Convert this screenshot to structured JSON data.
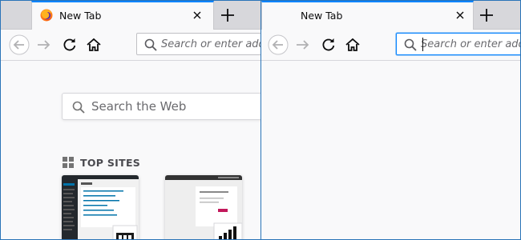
{
  "left_window": {
    "tab": {
      "title": "New Tab"
    },
    "toolbar": {
      "url_placeholder": "Search or enter address"
    },
    "newtab_page": {
      "search_placeholder": "Search the Web",
      "top_sites_heading": "TOP SITES"
    }
  },
  "right_window": {
    "tab": {
      "title": "New Tab"
    },
    "toolbar": {
      "url_placeholder": "Search or enter address"
    }
  },
  "icons": [
    "firefox-logo",
    "close-icon",
    "plus-icon",
    "back-arrow-icon",
    "forward-arrow-icon",
    "reload-icon",
    "home-icon",
    "search-icon",
    "grid-icon"
  ],
  "colors": {
    "accent": "#0a84ff",
    "window_border": "#2a74b8",
    "tab_strip": "#d7d7db",
    "toolbar": "#f9f9fa"
  }
}
